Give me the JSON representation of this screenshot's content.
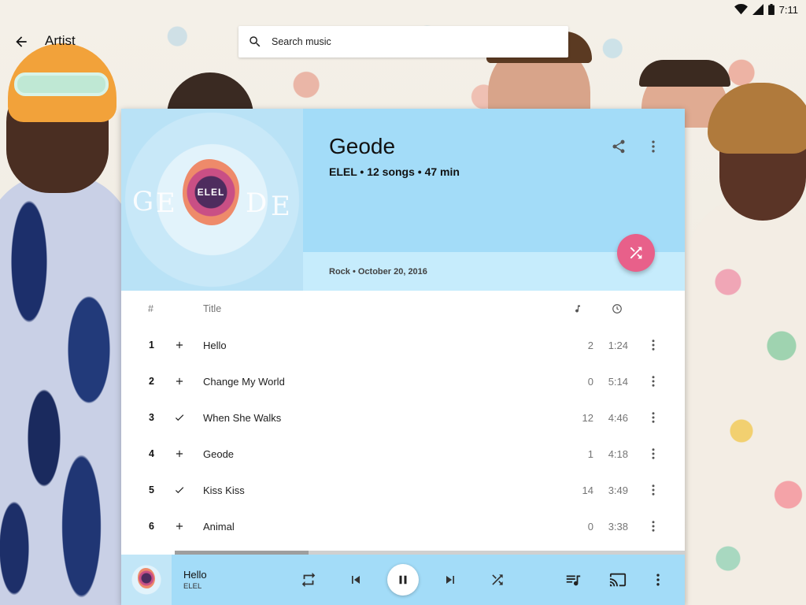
{
  "status_bar": {
    "time": "7:11"
  },
  "topbar": {
    "title": "Artist"
  },
  "search": {
    "placeholder": "Search music"
  },
  "album": {
    "title": "Geode",
    "meta": "ELEL • 12 songs • 47 min",
    "genre_date": "Rock • October 20, 2016",
    "art_text": "ELEL",
    "art_letters": [
      "G",
      "E",
      "D",
      "E"
    ]
  },
  "tracklist": {
    "header": {
      "number": "#",
      "title": "Title",
      "plays_icon": "music-note-icon",
      "duration_icon": "clock-icon"
    },
    "tracks": [
      {
        "number": "1",
        "status": "add",
        "title": "Hello",
        "plays": "2",
        "duration": "1:24"
      },
      {
        "number": "2",
        "status": "add",
        "title": "Change My World",
        "plays": "0",
        "duration": "5:14"
      },
      {
        "number": "3",
        "status": "added",
        "title": "When She Walks",
        "plays": "12",
        "duration": "4:46"
      },
      {
        "number": "4",
        "status": "add",
        "title": "Geode",
        "plays": "1",
        "duration": "4:18"
      },
      {
        "number": "5",
        "status": "added",
        "title": "Kiss Kiss",
        "plays": "14",
        "duration": "3:49"
      },
      {
        "number": "6",
        "status": "add",
        "title": "Animal",
        "plays": "0",
        "duration": "3:38"
      }
    ]
  },
  "now_playing": {
    "title": "Hello",
    "artist": "ELEL",
    "art_text": "ELEL",
    "state": "playing"
  },
  "colors": {
    "header_bg": "#a3dcf8",
    "header_band": "#c6ecfc",
    "fab": "#e8608a"
  }
}
